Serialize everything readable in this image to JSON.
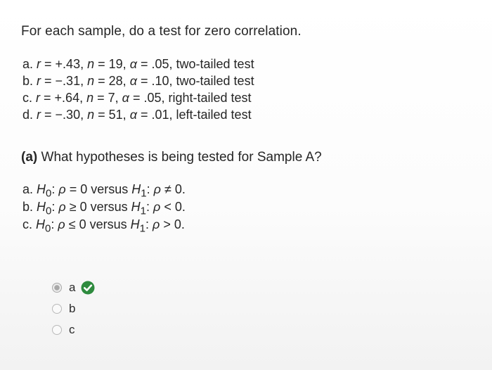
{
  "prompt": "For each sample, do a test for zero correlation.",
  "samples": [
    {
      "letter": "a.",
      "r": "+.43",
      "n": "19",
      "alpha": ".05",
      "test": "two-tailed test"
    },
    {
      "letter": "b.",
      "r": "−.31",
      "n": "28",
      "alpha": ".10",
      "test": "two-tailed test"
    },
    {
      "letter": "c.",
      "r": "+.64",
      "n": "7",
      "alpha": ".05",
      "test": "right-tailed test"
    },
    {
      "letter": "d.",
      "r": "−.30",
      "n": "51",
      "alpha": ".01",
      "test": "left-tailed test"
    }
  ],
  "question": {
    "tag": "(a)",
    "text": "What hypotheses is being tested for Sample A?"
  },
  "options": [
    {
      "letter": "a.",
      "h0_rel": "=",
      "h1_rel": "≠"
    },
    {
      "letter": "b.",
      "h0_rel": "≥",
      "h1_rel": "<"
    },
    {
      "letter": "c.",
      "h0_rel": "≤",
      "h1_rel": ">"
    }
  ],
  "answers": [
    {
      "label": "a",
      "selected": true,
      "correct": true
    },
    {
      "label": "b",
      "selected": false,
      "correct": false
    },
    {
      "label": "c",
      "selected": false,
      "correct": false
    }
  ],
  "colors": {
    "check_green": "#2e8b3e",
    "text": "#262626"
  },
  "icons": {
    "correct": "check-circle-icon"
  }
}
